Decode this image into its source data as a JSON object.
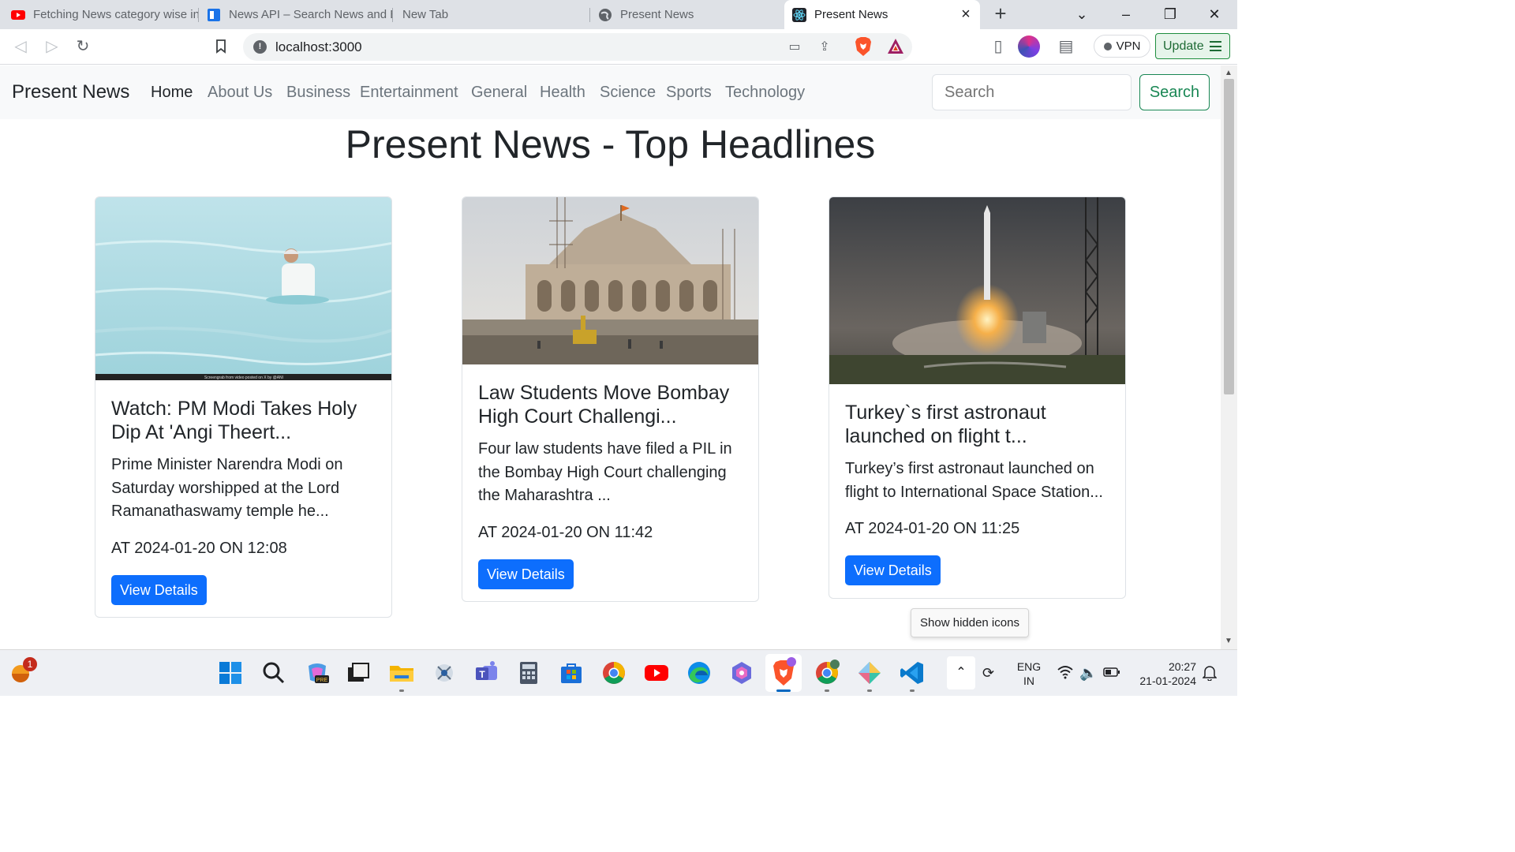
{
  "browser": {
    "tabs": [
      {
        "title": "Fetching News category wise in",
        "icon": "youtube-icon"
      },
      {
        "title": "News API – Search News and B",
        "icon": "newsapi-icon"
      },
      {
        "title": "New Tab",
        "icon": ""
      },
      {
        "title": "Present News",
        "icon": "globe-icon"
      },
      {
        "title": "Present News",
        "icon": "react-icon",
        "active": true
      }
    ],
    "url": "localhost:3000",
    "vpn_label": "VPN",
    "update_label": "Update"
  },
  "navbar": {
    "brand": "Present News",
    "links": [
      {
        "label": "Home",
        "active": true
      },
      {
        "label": "About Us"
      },
      {
        "label": "Business"
      },
      {
        "label": "Entertainment"
      },
      {
        "label": "General"
      },
      {
        "label": "Health"
      },
      {
        "label": "Science"
      },
      {
        "label": "Sports"
      },
      {
        "label": "Technology"
      }
    ],
    "search_placeholder": "Search",
    "search_button": "Search"
  },
  "page": {
    "title": "Present News - Top Headlines",
    "cards": [
      {
        "title": "Watch: PM Modi Takes Holy Dip At 'Angi Theert...",
        "description": "Prime Minister Narendra Modi on Saturday worshipped at the Lord Ramanathaswamy temple he...",
        "date": "AT 2024-01-20 ON 12:08",
        "button": "View Details",
        "image_caption": "Screengrab from video posted on X by @ANI"
      },
      {
        "title": "Law Students Move Bombay High Court Challengi...",
        "description": "Four law students have filed a PIL in the Bombay High Court challenging the Maharashtra ...",
        "date": "AT 2024-01-20 ON 11:42",
        "button": "View Details"
      },
      {
        "title": "Turkey`s first astronaut launched on flight t...",
        "description": "Turkey’s first astronaut launched on flight to International Space Station...",
        "date": "AT 2024-01-20 ON 11:25",
        "button": "View Details"
      }
    ]
  },
  "tooltip": "Show hidden icons",
  "taskbar": {
    "weather_badge": "1",
    "language": [
      "ENG",
      "IN"
    ],
    "time": "20:27",
    "date": "21-01-2024",
    "apps": [
      "start-icon",
      "search-icon",
      "copilot-icon",
      "task-view-icon",
      "file-explorer-icon",
      "snipping-tool-icon",
      "teams-icon",
      "calculator-icon",
      "store-icon",
      "chrome-icon",
      "youtube-icon",
      "edge-icon",
      "copilot-app-icon",
      "brave-icon",
      "chrome-profile-icon",
      "photos-icon",
      "vscode-icon"
    ]
  },
  "colors": {
    "primary": "#0d6efd",
    "success": "#198754",
    "navbar_bg": "#f8f9fa"
  }
}
